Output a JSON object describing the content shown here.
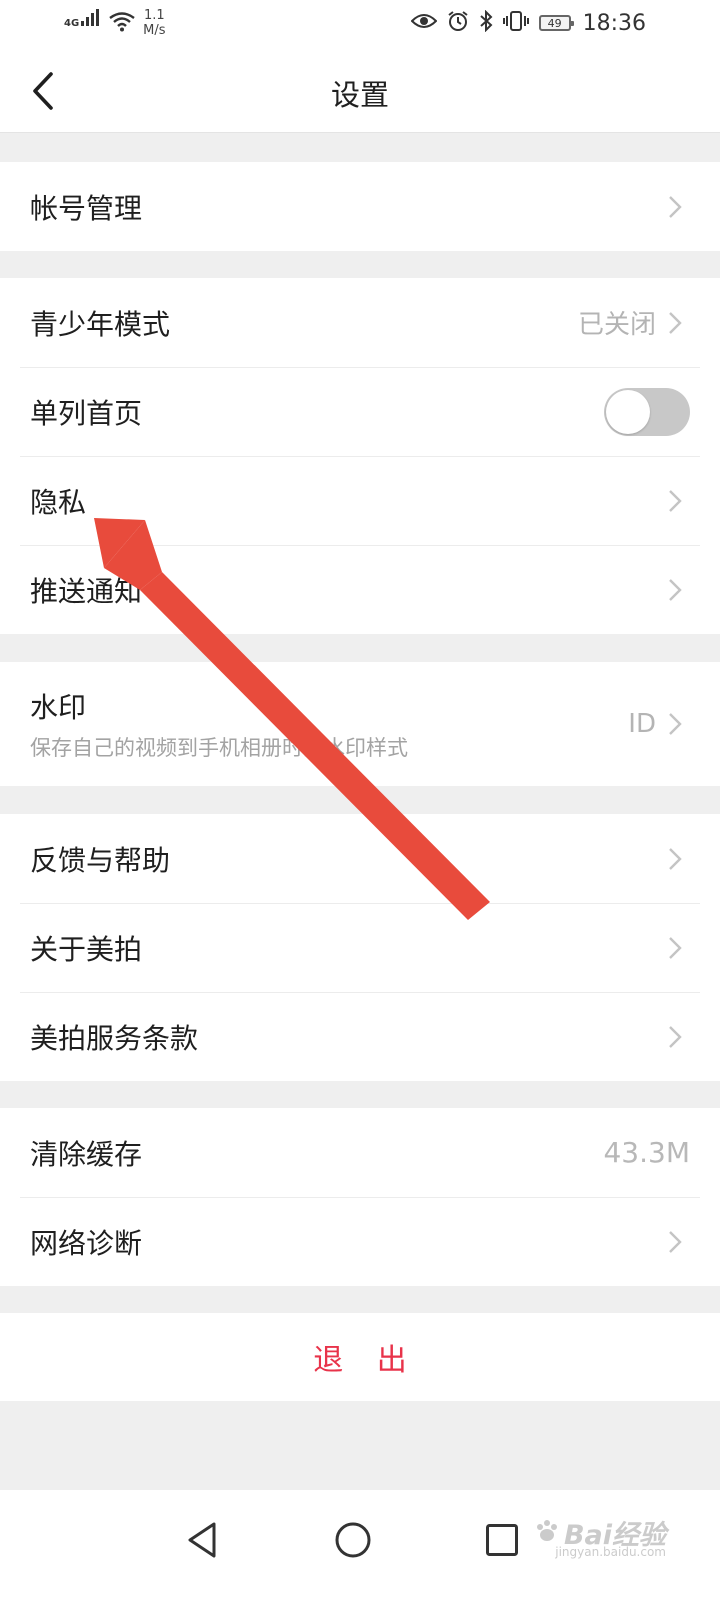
{
  "status_bar": {
    "network_type": "4G",
    "speed_value": "1.1",
    "speed_unit": "M/s",
    "battery": "49",
    "time": "18:36",
    "icons": [
      "signal-icon",
      "wifi-icon",
      "eye-icon",
      "alarm-icon",
      "bluetooth-icon",
      "vibrate-icon",
      "battery-icon"
    ]
  },
  "header": {
    "title": "设置",
    "back_icon": "back-arrow-icon"
  },
  "groups": {
    "account": {
      "items": [
        {
          "label": "帐号管理"
        }
      ]
    },
    "general": {
      "items": [
        {
          "label": "青少年模式",
          "value": "已关闭"
        },
        {
          "label": "单列首页",
          "toggle": "off"
        },
        {
          "label": "隐私"
        },
        {
          "label": "推送通知"
        }
      ]
    },
    "watermark": {
      "items": [
        {
          "label": "水印",
          "subtitle": "保存自己的视频到手机相册时的水印样式",
          "value": "ID"
        }
      ]
    },
    "help": {
      "items": [
        {
          "label": "反馈与帮助"
        },
        {
          "label": "关于美拍"
        },
        {
          "label": "美拍服务条款"
        }
      ]
    },
    "storage": {
      "items": [
        {
          "label": "清除缓存",
          "value": "43.3M"
        },
        {
          "label": "网络诊断"
        }
      ]
    }
  },
  "logout": {
    "label": "退 出",
    "color": "#e8334a"
  },
  "bottom_nav": {
    "icons": [
      "nav-back-icon",
      "nav-home-icon",
      "nav-recent-icon"
    ]
  },
  "annotation": {
    "arrow_color": "#e84b3c"
  },
  "watermark_overlay": {
    "logo_text": "Bai经验",
    "site": "jingyan.baidu.com"
  },
  "colors": {
    "background": "#efefef",
    "accent": "#e8334a",
    "secondary_text": "#b4b4b4"
  }
}
